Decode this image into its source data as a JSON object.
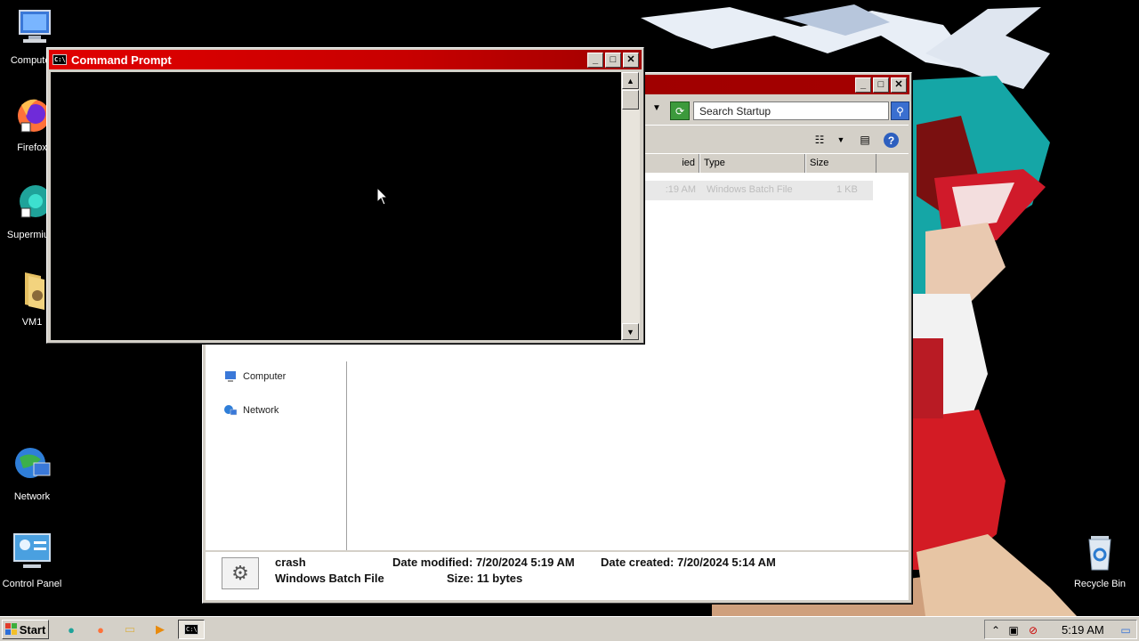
{
  "desktop": {
    "icons": [
      {
        "label": "Computer",
        "icon": "computer-icon"
      },
      {
        "label": "Firefox",
        "icon": "firefox-icon"
      },
      {
        "label": "Supermium",
        "icon": "supermium-icon"
      },
      {
        "label": "VM1",
        "icon": "folder-icon"
      },
      {
        "label": "Network",
        "icon": "network-icon"
      },
      {
        "label": "Control Panel",
        "icon": "control-panel-icon"
      },
      {
        "label": "Recycle Bin",
        "icon": "recycle-bin-icon"
      }
    ]
  },
  "cmd_window": {
    "title": "Command Prompt"
  },
  "explorer": {
    "search_placeholder": "Search Startup",
    "columns": [
      "ied",
      "Type",
      "Size"
    ],
    "file_row": {
      "modified": ":19 AM",
      "type": "Windows Batch File",
      "size": "1 KB"
    },
    "nav_items": [
      {
        "label": "Computer",
        "icon": "computer-icon"
      },
      {
        "label": "Network",
        "icon": "network-icon"
      }
    ],
    "details": {
      "name": "crash",
      "type": "Windows Batch File",
      "date_modified": "Date modified: 7/20/2024 5:19 AM",
      "date_created": "Date created: 7/20/2024 5:14 AM",
      "size": "Size: 11 bytes"
    }
  },
  "taskbar": {
    "start_label": "Start",
    "clock": "5:19 AM"
  },
  "colors": {
    "titlebar_active": "#e00000",
    "window_face": "#d4d0c8"
  }
}
